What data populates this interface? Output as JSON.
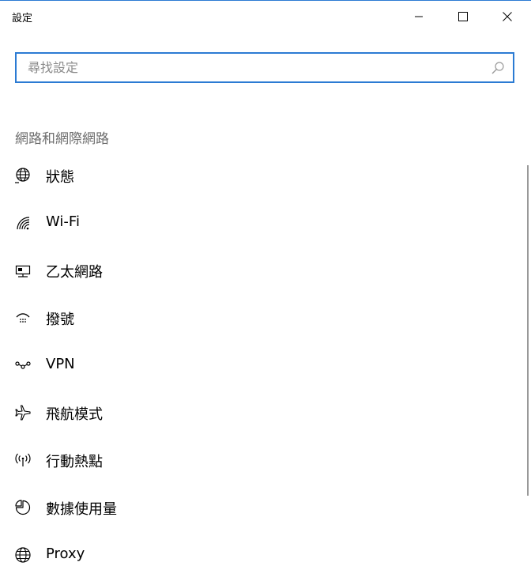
{
  "window": {
    "title": "設定"
  },
  "search": {
    "placeholder": "尋找設定",
    "value": ""
  },
  "section": {
    "title": "網路和網際網路"
  },
  "nav": {
    "items": [
      {
        "label": "狀態",
        "icon": "globe-status-icon"
      },
      {
        "label": "Wi-Fi",
        "icon": "wifi-icon"
      },
      {
        "label": "乙太網路",
        "icon": "ethernet-icon"
      },
      {
        "label": "撥號",
        "icon": "dialup-icon"
      },
      {
        "label": "VPN",
        "icon": "vpn-icon"
      },
      {
        "label": "飛航模式",
        "icon": "airplane-icon"
      },
      {
        "label": "行動熱點",
        "icon": "hotspot-icon"
      },
      {
        "label": "數據使用量",
        "icon": "data-usage-icon"
      },
      {
        "label": "Proxy",
        "icon": "globe-icon"
      }
    ]
  },
  "colors": {
    "accent": "#2b7bd3",
    "section_text": "#6e6e6e",
    "text": "#000000",
    "placeholder": "#8a8a8a"
  }
}
